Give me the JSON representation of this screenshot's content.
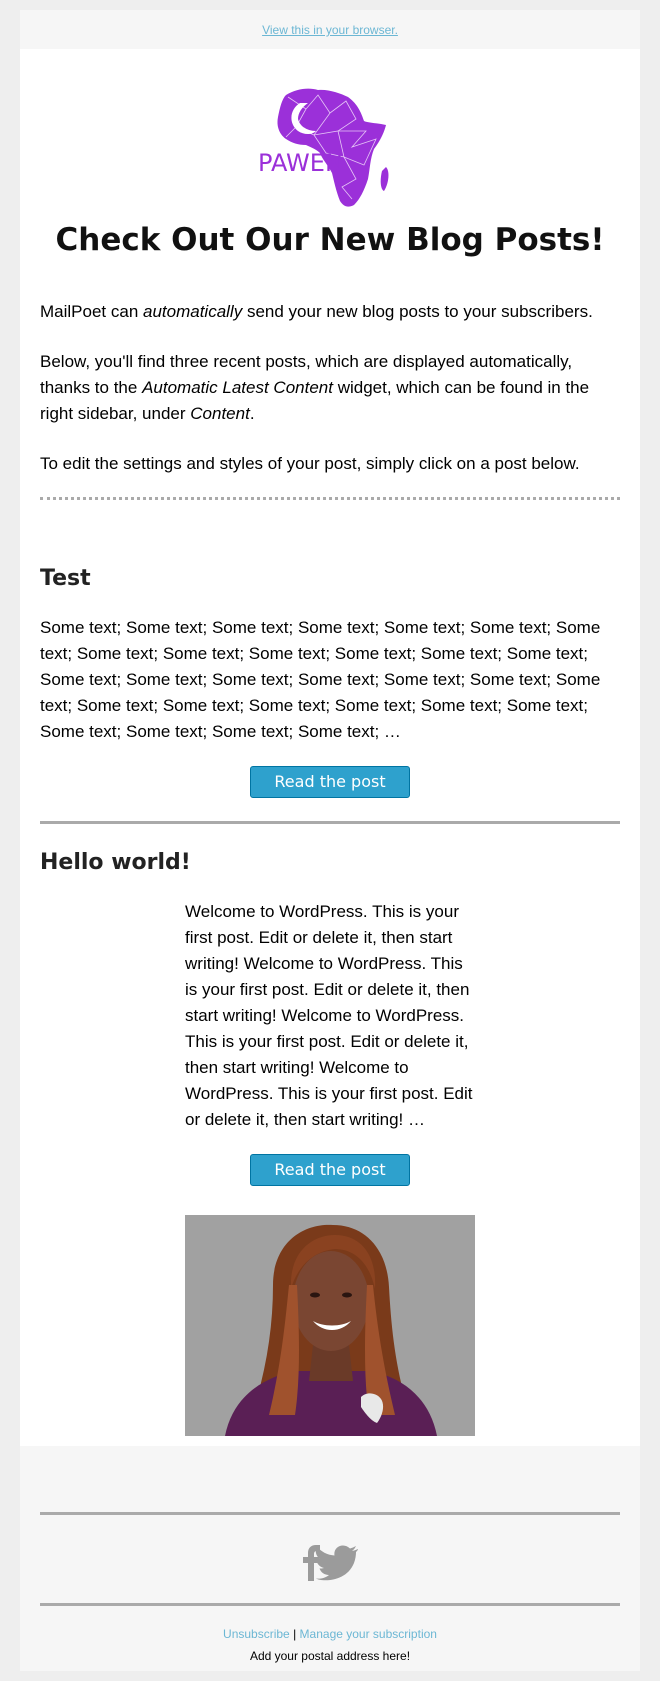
{
  "preheader": {
    "view_in_browser": "View this in your browser."
  },
  "logo": {
    "text": "PAWEN",
    "icon": "africa-map-logo-icon"
  },
  "heading": "Check Out Our New Blog Posts!",
  "intro": {
    "p1_before": "MailPoet can ",
    "p1_em": "automatically",
    "p1_after": " send your new blog posts to your subscribers.",
    "p2_before": "Below, you'll find three recent posts, which are displayed automatically, thanks to the ",
    "p2_em1": "Automatic Latest Content",
    "p2_mid": " widget, which can be found in the right sidebar, under ",
    "p2_em2": "Content",
    "p2_end": ".",
    "p3": "To edit the settings and styles of your post, simply click on a post below."
  },
  "posts": [
    {
      "title": "Test",
      "excerpt": "Some text; Some text; Some text; Some text; Some text; Some text; Some text; Some text; Some text; Some text; Some text; Some text; Some text; Some text; Some text; Some text; Some text; Some text; Some text; Some text; Some text; Some text; Some text; Some text; Some text; Some text; Some text; Some text; Some text; Some text; …",
      "button": "Read the post"
    },
    {
      "title": "Hello world!",
      "excerpt": "Welcome to WordPress. This is your first post. Edit or delete it, then start writing! Welcome to WordPress. This is your first post. Edit or delete it, then start writing! Welcome to WordPress. This is your first post. Edit or delete it, then start writing! Welcome to WordPress. This is your first post. Edit or delete it, then start writing! …",
      "button": "Read the post"
    }
  ],
  "footer": {
    "social": [
      "facebook-icon",
      "twitter-icon"
    ],
    "unsubscribe": "Unsubscribe",
    "separator": "|",
    "manage": "Manage your subscription",
    "address": "Add your postal address here!"
  },
  "colors": {
    "link": "#6cb7d4",
    "button": "#2ea1cd",
    "logo_purple": "#9b30d9",
    "divider": "#aaaaaa"
  }
}
